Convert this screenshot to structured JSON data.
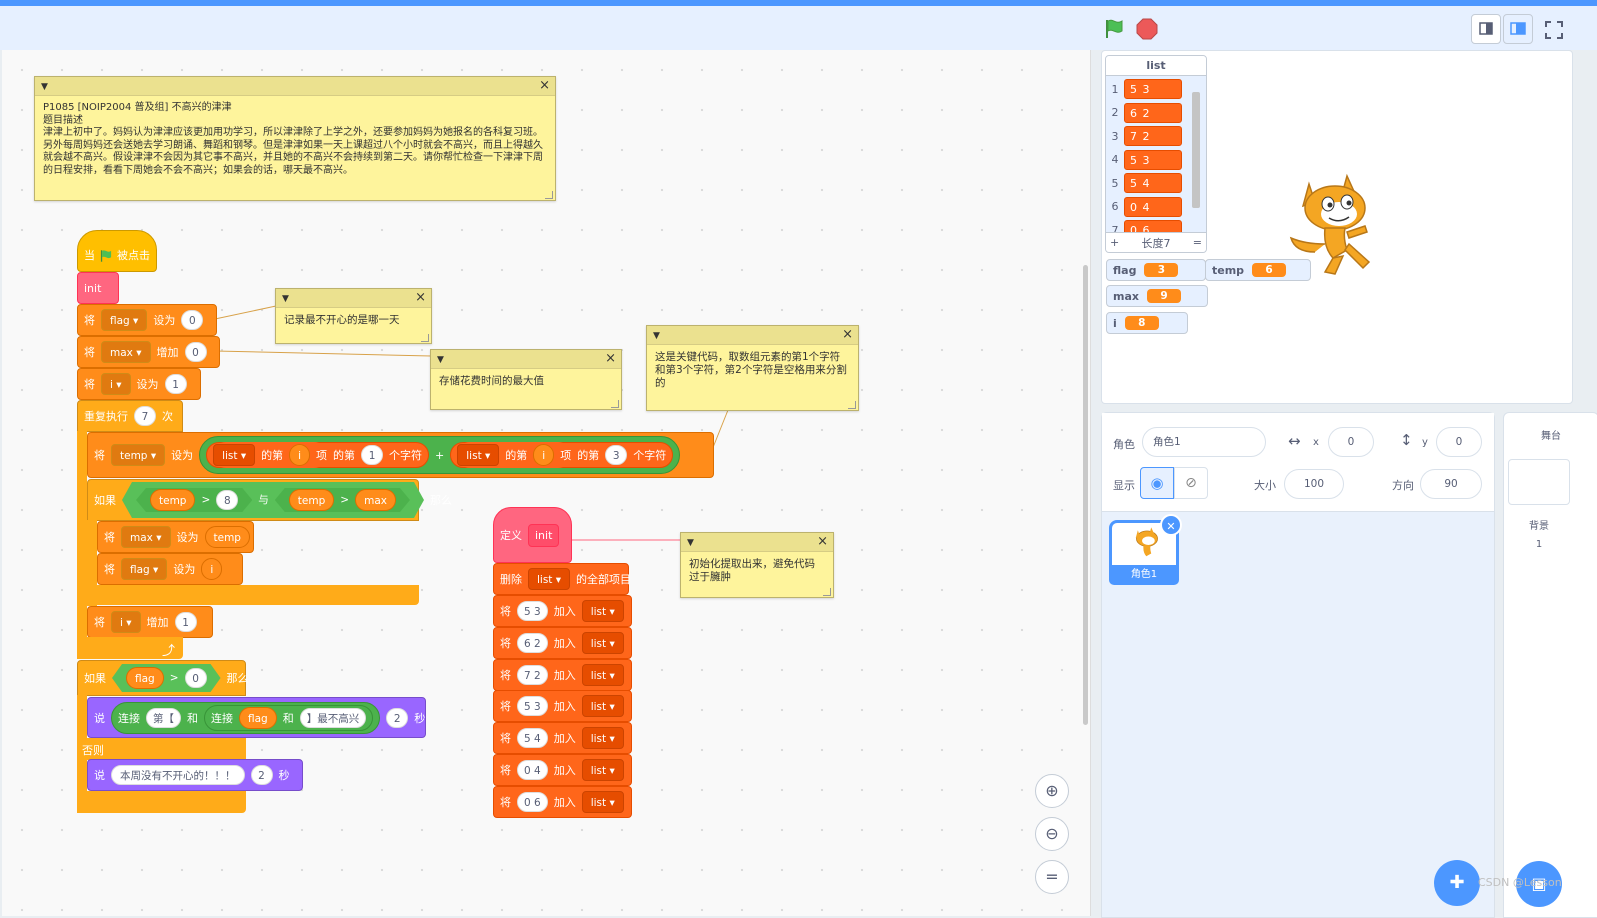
{
  "header": {
    "green_flag_label": "",
    "stop_label": ""
  },
  "comments": {
    "problem": "P1085 [NOIP2004 普及组] 不高兴的津津\n题目描述\n津津上初中了。妈妈认为津津应该更加用功学习，所以津津除了上学之外，还要参加妈妈为她报名的各科复习班。另外每周妈妈还会送她去学习朗诵、舞蹈和钢琴。但是津津如果一天上课超过八个小时就会不高兴，而且上得越久就会越不高兴。假设津津不会因为其它事不高兴，并且她的不高兴不会持续到第二天。请你帮忙检查一下津津下周的日程安排，看看下周她会不会不高兴；如果会的话，哪天最不高兴。",
    "flag_note": "记录最不开心的是哪一天",
    "max_note": "存储花费时间的最大值",
    "key_note": "这是关键代码，取数组元素的第1个字符和第3个字符，第2个字符是空格用来分割的",
    "init_note": "初始化提取出来，避免代码过于臃肿"
  },
  "main_script": {
    "hat_when": "当",
    "hat_clicked": "被点击",
    "init": "init",
    "set_word": "将",
    "set_to": "设为",
    "change_by": "增加",
    "flag": "flag",
    "max": "max",
    "i": "i",
    "temp": "temp",
    "zero": "0",
    "one": "1",
    "repeat": "重复执行",
    "times": "次",
    "seven": "7",
    "list": "list",
    "item_of": "的第",
    "item": "项",
    "char_of": "的第",
    "char": "个字符",
    "three": "3",
    "plus": "+",
    "if": "如果",
    "then": "那么",
    "gt": ">",
    "and": "与",
    "eight": "8",
    "else": "否则",
    "say": "说",
    "join": "连接",
    "join_and": "和",
    "day_prefix": "第【",
    "day_suffix": "】最不高兴",
    "two": "2",
    "seconds": "秒",
    "no_unhappy": "本周没有不开心的！！！"
  },
  "define_script": {
    "define": "定义",
    "name": "init",
    "delete_all": "删除",
    "all_items": "的全部项目",
    "add": "加入",
    "values": [
      "5 3",
      "6 2",
      "7 2",
      "5 3",
      "5 4",
      "0 4",
      "0 6"
    ]
  },
  "stage": {
    "list_title": "list",
    "list_items": [
      "5 3",
      "6 2",
      "7 2",
      "5 3",
      "5 4",
      "0 4",
      "0 6"
    ],
    "list_length": "长度7",
    "list_plus": "+",
    "list_eq": "=",
    "monitors": [
      {
        "name": "flag",
        "value": "3"
      },
      {
        "name": "temp",
        "value": "6"
      },
      {
        "name": "max",
        "value": "9"
      },
      {
        "name": "i",
        "value": "8"
      }
    ]
  },
  "sprite_info": {
    "sprite_label": "角色",
    "sprite_name": "角色1",
    "x_label": "x",
    "x_value": "0",
    "y_label": "y",
    "y_value": "0",
    "show_label": "显示",
    "size_label": "大小",
    "size_value": "100",
    "direction_label": "方向",
    "direction_value": "90"
  },
  "sprite_list": {
    "items": [
      {
        "name": "角色1"
      }
    ]
  },
  "stage_panel": {
    "title": "舞台",
    "backdrop_label": "背景",
    "backdrop_count": "1"
  },
  "watermark": "CSDN @Lesson"
}
